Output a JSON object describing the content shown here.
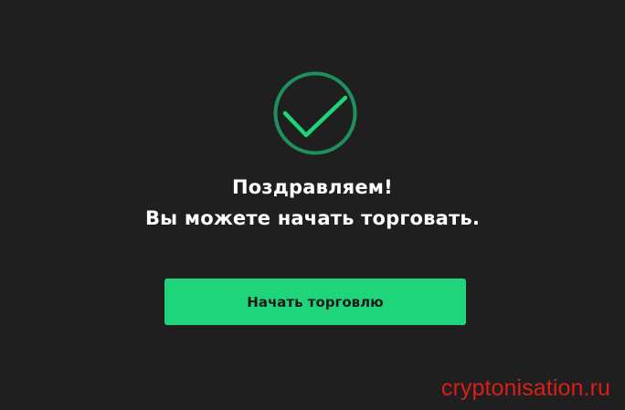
{
  "success_dialog": {
    "icon": "checkmark-icon",
    "title": "Поздравляем!",
    "subtitle": "Вы можете начать торговать.",
    "button_label": "Начать торговлю"
  },
  "watermark": {
    "text": "cryptonisation.ru"
  },
  "colors": {
    "background": "#1f1f1f",
    "accent": "#1fd47a",
    "check_ring": "#1e8f5f",
    "check_mark": "#1fd47a",
    "text": "#ffffff",
    "button_text": "#1b1b1b",
    "watermark": "#d91f18"
  }
}
